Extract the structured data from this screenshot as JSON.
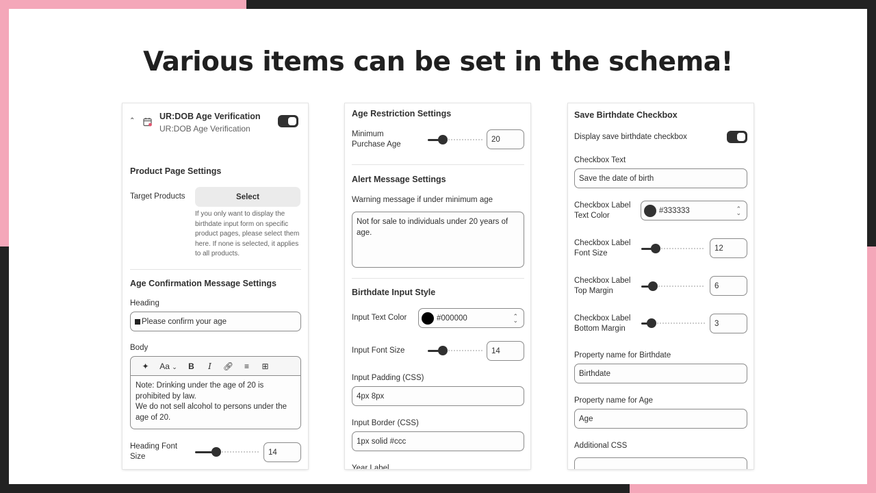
{
  "headline": "Various items can be set in the schema!",
  "colors": {
    "pink": "#f4a7b9",
    "dark": "#222222",
    "text": "#303030"
  },
  "panel1": {
    "app_title": "UR:DOB Age Verification",
    "app_subtitle": "UR:DOB Age Verification",
    "app_enabled": true,
    "product_section": "Product Page Settings",
    "target_label": "Target Products",
    "select_label": "Select",
    "target_help": "If you only want to display the birthdate input form on specific product pages, please select them here. If none is selected, it applies to all products.",
    "confirm_section": "Age Confirmation Message Settings",
    "heading_label": "Heading",
    "heading_value": "Please confirm your age",
    "body_label": "Body",
    "toolbar_text_style": "Aa",
    "toolbar_bold": "B",
    "toolbar_italic": "I",
    "body_line1": "Note: Drinking under the age of 20 is prohibited by law.",
    "body_line2": "We do not sell alcohol to persons under the age of 20.",
    "heading_font_size_label": "Heading Font Size",
    "heading_font_size_value": "14",
    "heading_font_size_level": 0.3
  },
  "panel2": {
    "age_section": "Age Restriction Settings",
    "min_age_label": "Minimum Purchase Age",
    "min_age_value": "20",
    "min_age_level": 0.23,
    "alert_section": "Alert Message Settings",
    "warning_label": "Warning message if under minimum age",
    "warning_value": "Not for sale to individuals under 20 years of age.",
    "input_style_section": "Birthdate Input Style",
    "input_text_color_label": "Input Text Color",
    "input_text_color_value": "#000000",
    "input_text_color_swatch": "#000000",
    "input_font_size_label": "Input Font Size",
    "input_font_size_value": "14",
    "input_font_size_level": 0.23,
    "input_padding_label": "Input Padding (CSS)",
    "input_padding_value": "4px 8px",
    "input_border_label": "Input Border (CSS)",
    "input_border_value": "1px solid #ccc",
    "year_label": "Year Label"
  },
  "panel3": {
    "save_section": "Save Birthdate Checkbox",
    "display_checkbox_label": "Display save birthdate checkbox",
    "display_checkbox_enabled": true,
    "checkbox_text_label": "Checkbox Text",
    "checkbox_text_value": "Save the date of birth",
    "label_color_label": "Checkbox Label Text Color",
    "label_color_value": "#333333",
    "label_color_swatch": "#333333",
    "label_font_size_label": "Checkbox Label Font Size",
    "label_font_size_value": "12",
    "label_font_size_level": 0.18,
    "label_top_margin_label": "Checkbox Label Top Margin",
    "label_top_margin_value": "6",
    "label_top_margin_level": 0.13,
    "label_bottom_margin_label": "Checkbox Label Bottom Margin",
    "label_bottom_margin_value": "3",
    "label_bottom_margin_level": 0.1,
    "prop_birthdate_label": "Property name for Birthdate",
    "prop_birthdate_value": "Birthdate",
    "prop_age_label": "Property name for Age",
    "prop_age_value": "Age",
    "additional_css_label": "Additional CSS"
  }
}
